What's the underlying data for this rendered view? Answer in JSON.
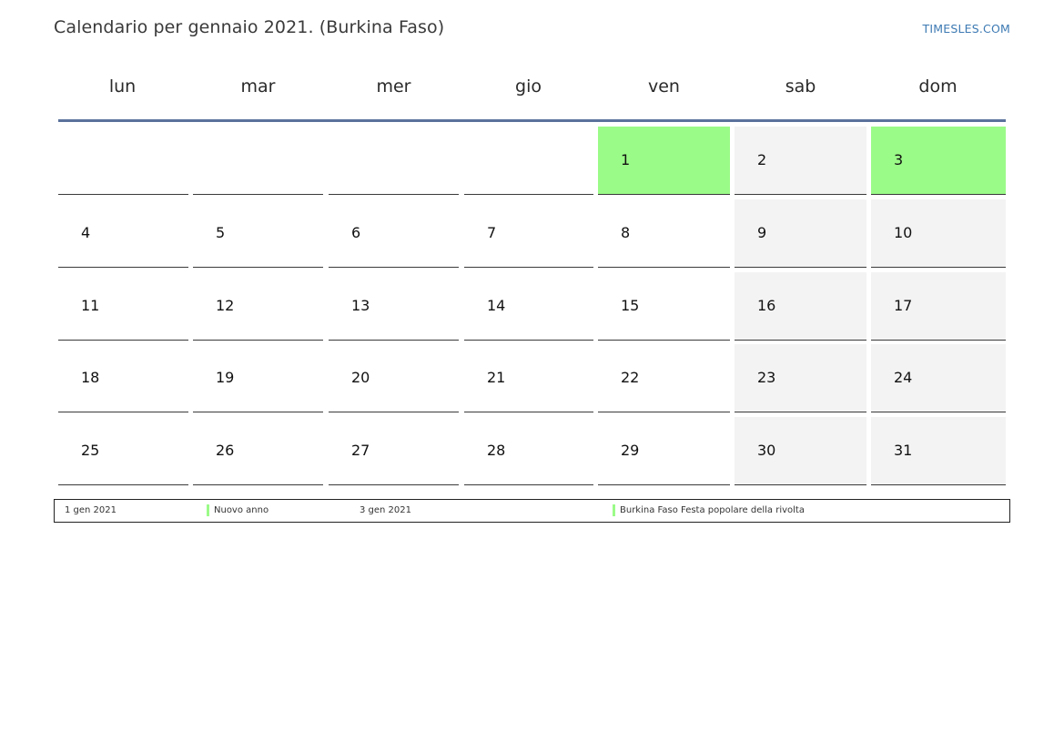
{
  "header": {
    "title": "Calendario per gennaio 2021. (Burkina Faso)",
    "brand": "TIMESLES.COM"
  },
  "weekdays": [
    "lun",
    "mar",
    "mer",
    "gio",
    "ven",
    "sab",
    "dom"
  ],
  "weeks": [
    [
      "",
      "",
      "",
      "",
      "1",
      "2",
      "3"
    ],
    [
      "4",
      "5",
      "6",
      "7",
      "8",
      "9",
      "10"
    ],
    [
      "11",
      "12",
      "13",
      "14",
      "15",
      "16",
      "17"
    ],
    [
      "18",
      "19",
      "20",
      "21",
      "22",
      "23",
      "24"
    ],
    [
      "25",
      "26",
      "27",
      "28",
      "29",
      "30",
      "31"
    ]
  ],
  "holiday_days": [
    "1",
    "3"
  ],
  "weekend_columns": [
    5,
    6
  ],
  "colors": {
    "holiday": "#9bfb88",
    "weekend": "#f3f3f3",
    "header_rule": "#5a729b",
    "brand": "#3d7ab3"
  },
  "legend": [
    {
      "date": "1 gen 2021",
      "name": "Nuovo anno"
    },
    {
      "date": "3 gen 2021",
      "name": "Burkina Faso Festa popolare della rivolta"
    }
  ]
}
